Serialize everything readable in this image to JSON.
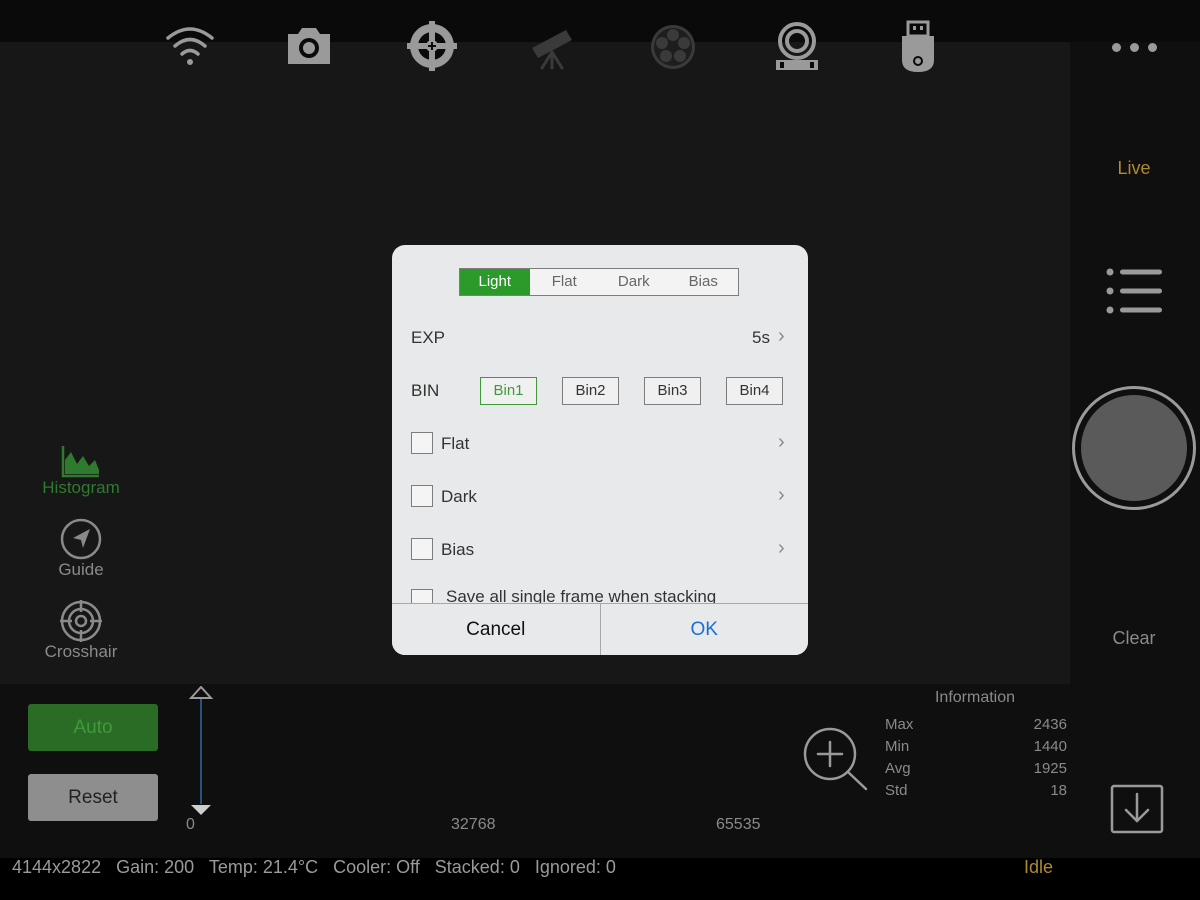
{
  "top_toolbar": {
    "icons": [
      "wifi-icon",
      "camera-icon",
      "mount-icon",
      "telescope-icon",
      "filter-wheel-icon",
      "focuser-icon",
      "usb-storage-icon",
      "more-icon"
    ]
  },
  "right_panel": {
    "live_label": "Live",
    "clear_label": "Clear"
  },
  "tools": {
    "histogram": "Histogram",
    "guide": "Guide",
    "crosshair": "Crosshair"
  },
  "histogram_panel": {
    "auto_label": "Auto",
    "reset_label": "Reset",
    "ticks": [
      "0",
      "32768",
      "65535"
    ]
  },
  "information": {
    "title": "Information",
    "rows": [
      {
        "label": "Max",
        "value": "2436"
      },
      {
        "label": "Min",
        "value": "1440"
      },
      {
        "label": "Avg",
        "value": "1925"
      },
      {
        "label": "Std",
        "value": "18"
      }
    ]
  },
  "status": {
    "text": "4144x2822   Gain: 200   Temp: 21.4°C   Cooler: Off   Stacked: 0   Ignored: 0",
    "state": "Idle"
  },
  "dialog": {
    "frame_types": [
      "Light",
      "Flat",
      "Dark",
      "Bias"
    ],
    "selected_frame_type": "Light",
    "exp_label": "EXP",
    "exp_value": "5s",
    "bin_label": "BIN",
    "bins": [
      "Bin1",
      "Bin2",
      "Bin3",
      "Bin4"
    ],
    "selected_bin": "Bin1",
    "calibration": [
      {
        "label": "Flat",
        "checked": false
      },
      {
        "label": "Dark",
        "checked": false
      },
      {
        "label": "Bias",
        "checked": false
      }
    ],
    "save_single_label": "Save all single frame when stacking",
    "cancel_label": "Cancel",
    "ok_label": "OK"
  },
  "colors": {
    "accent_green": "#2c9a2a",
    "accent_gold": "#b08a2e",
    "ok_blue": "#1a6fd6"
  }
}
